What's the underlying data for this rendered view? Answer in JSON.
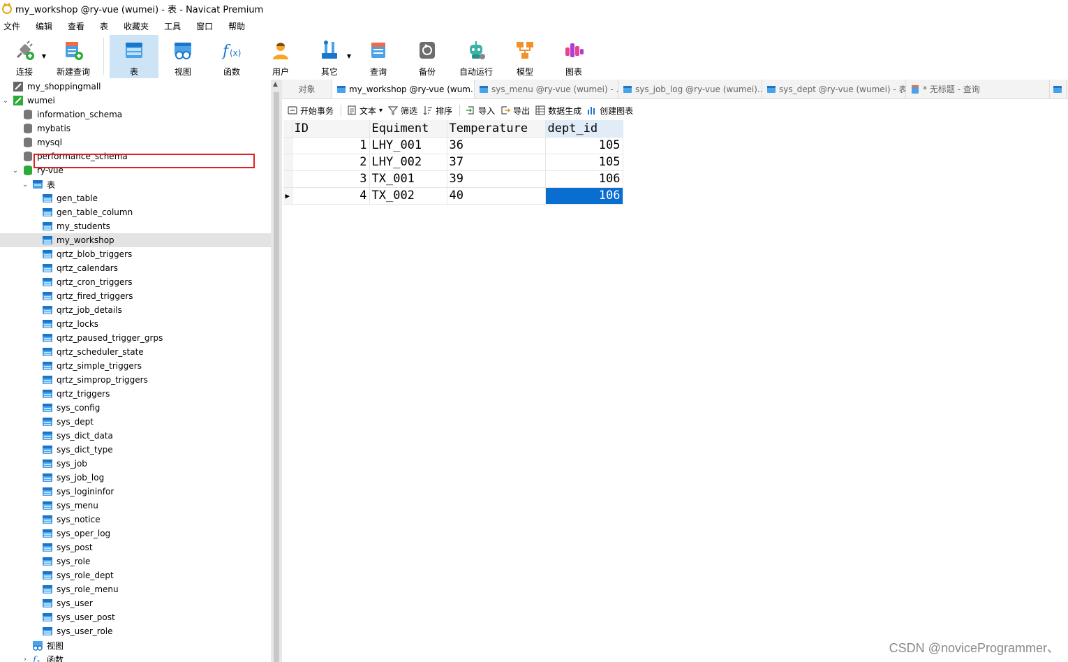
{
  "window": {
    "title": "my_workshop @ry-vue (wumei) - 表 - Navicat Premium"
  },
  "menu": [
    "文件",
    "编辑",
    "查看",
    "表",
    "收藏夹",
    "工具",
    "窗口",
    "帮助"
  ],
  "toolbar": [
    {
      "label": "连接",
      "icon": "connect-icon"
    },
    {
      "label": "新建查询",
      "icon": "new-query-icon"
    },
    {
      "label": "表",
      "icon": "table-icon"
    },
    {
      "label": "视图",
      "icon": "view-icon"
    },
    {
      "label": "函数",
      "icon": "function-icon"
    },
    {
      "label": "用户",
      "icon": "user-icon"
    },
    {
      "label": "其它",
      "icon": "other-icon"
    },
    {
      "label": "查询",
      "icon": "query-icon"
    },
    {
      "label": "备份",
      "icon": "backup-icon"
    },
    {
      "label": "自动运行",
      "icon": "robot-icon"
    },
    {
      "label": "模型",
      "icon": "model-icon"
    },
    {
      "label": "图表",
      "icon": "chart-icon"
    }
  ],
  "tree": [
    {
      "label": "my_shoppingmall",
      "level": 0,
      "kind": "conn-off"
    },
    {
      "label": "wumei",
      "level": 0,
      "kind": "conn-on",
      "open": true
    },
    {
      "label": "information_schema",
      "level": 1,
      "kind": "db"
    },
    {
      "label": "mybatis",
      "level": 1,
      "kind": "db"
    },
    {
      "label": "mysql",
      "level": 1,
      "kind": "db"
    },
    {
      "label": "performance_schema",
      "level": 1,
      "kind": "db"
    },
    {
      "label": "ry-vue",
      "level": 1,
      "kind": "db-open",
      "open": true
    },
    {
      "label": "表",
      "level": 2,
      "kind": "folder-table",
      "open": true
    },
    {
      "label": "gen_table",
      "level": 3,
      "kind": "table"
    },
    {
      "label": "gen_table_column",
      "level": 3,
      "kind": "table"
    },
    {
      "label": "my_students",
      "level": 3,
      "kind": "table"
    },
    {
      "label": "my_workshop",
      "level": 3,
      "kind": "table",
      "selected": true
    },
    {
      "label": "qrtz_blob_triggers",
      "level": 3,
      "kind": "table"
    },
    {
      "label": "qrtz_calendars",
      "level": 3,
      "kind": "table"
    },
    {
      "label": "qrtz_cron_triggers",
      "level": 3,
      "kind": "table"
    },
    {
      "label": "qrtz_fired_triggers",
      "level": 3,
      "kind": "table"
    },
    {
      "label": "qrtz_job_details",
      "level": 3,
      "kind": "table"
    },
    {
      "label": "qrtz_locks",
      "level": 3,
      "kind": "table"
    },
    {
      "label": "qrtz_paused_trigger_grps",
      "level": 3,
      "kind": "table"
    },
    {
      "label": "qrtz_scheduler_state",
      "level": 3,
      "kind": "table"
    },
    {
      "label": "qrtz_simple_triggers",
      "level": 3,
      "kind": "table"
    },
    {
      "label": "qrtz_simprop_triggers",
      "level": 3,
      "kind": "table"
    },
    {
      "label": "qrtz_triggers",
      "level": 3,
      "kind": "table"
    },
    {
      "label": "sys_config",
      "level": 3,
      "kind": "table"
    },
    {
      "label": "sys_dept",
      "level": 3,
      "kind": "table"
    },
    {
      "label": "sys_dict_data",
      "level": 3,
      "kind": "table"
    },
    {
      "label": "sys_dict_type",
      "level": 3,
      "kind": "table"
    },
    {
      "label": "sys_job",
      "level": 3,
      "kind": "table"
    },
    {
      "label": "sys_job_log",
      "level": 3,
      "kind": "table"
    },
    {
      "label": "sys_logininfor",
      "level": 3,
      "kind": "table"
    },
    {
      "label": "sys_menu",
      "level": 3,
      "kind": "table"
    },
    {
      "label": "sys_notice",
      "level": 3,
      "kind": "table"
    },
    {
      "label": "sys_oper_log",
      "level": 3,
      "kind": "table"
    },
    {
      "label": "sys_post",
      "level": 3,
      "kind": "table"
    },
    {
      "label": "sys_role",
      "level": 3,
      "kind": "table"
    },
    {
      "label": "sys_role_dept",
      "level": 3,
      "kind": "table"
    },
    {
      "label": "sys_role_menu",
      "level": 3,
      "kind": "table"
    },
    {
      "label": "sys_user",
      "level": 3,
      "kind": "table"
    },
    {
      "label": "sys_user_post",
      "level": 3,
      "kind": "table"
    },
    {
      "label": "sys_user_role",
      "level": 3,
      "kind": "table"
    },
    {
      "label": "视图",
      "level": 2,
      "kind": "folder-view"
    },
    {
      "label": "函数",
      "level": 2,
      "kind": "folder-func",
      "closed": true
    }
  ],
  "tabs": [
    {
      "label": "对象",
      "kind": "objects"
    },
    {
      "label": "my_workshop @ry-vue (wum...",
      "kind": "table",
      "active": true
    },
    {
      "label": "sys_menu @ry-vue (wumei) - ...",
      "kind": "table"
    },
    {
      "label": "sys_job_log @ry-vue (wumei)...",
      "kind": "table"
    },
    {
      "label": "sys_dept @ry-vue (wumei) - 表",
      "kind": "table"
    },
    {
      "label": "* 无标题 - 查询",
      "kind": "query"
    }
  ],
  "subtoolbar": [
    {
      "label": "开始事务",
      "icon": "transaction-icon"
    },
    {
      "label": "文本",
      "icon": "text-icon",
      "dropdown": true
    },
    {
      "label": "筛选",
      "icon": "filter-icon"
    },
    {
      "label": "排序",
      "icon": "sort-icon"
    },
    {
      "label": "导入",
      "icon": "import-icon"
    },
    {
      "label": "导出",
      "icon": "export-icon"
    },
    {
      "label": "数据生成",
      "icon": "data-generate-icon"
    },
    {
      "label": "创建图表",
      "icon": "create-chart-icon"
    }
  ],
  "grid": {
    "columns": [
      "ID",
      "Equiment",
      "Temperature",
      "dept_id"
    ],
    "rows": [
      [
        "1",
        "LHY_001",
        "36",
        "105"
      ],
      [
        "2",
        "LHY_002",
        "37",
        "105"
      ],
      [
        "3",
        "TX_001",
        "39",
        "106"
      ],
      [
        "4",
        "TX_002",
        "40",
        "106"
      ]
    ],
    "current_row": 3,
    "selected_column": 3
  },
  "watermark": "CSDN @noviceProgrammer、",
  "colors": {
    "accent": "#0a6ed1",
    "highlight": "#cde3f6",
    "selection_border": "#e02020"
  }
}
